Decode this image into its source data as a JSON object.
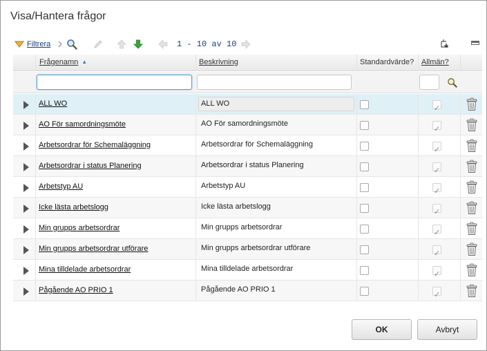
{
  "dialog": {
    "title": "Visa/Hantera frågor"
  },
  "toolbar": {
    "filter_label": "Filtrera",
    "pager_text": "1 - 10 av 10"
  },
  "columns": {
    "name": "Frågenamn",
    "description": "Beskrivning",
    "default": "Standardvärde?",
    "public": "Allmän?"
  },
  "filters": {
    "name_value": "",
    "description_value": "",
    "public_value": ""
  },
  "rows": [
    {
      "name": "ALL WO",
      "description": "ALL WO",
      "default": false,
      "public": true,
      "selected": true
    },
    {
      "name": "AO För samordningsmöte",
      "description": "AO För samordningsmöte",
      "default": false,
      "public": true
    },
    {
      "name": "Arbetsordrar för Schemaläggning",
      "description": "Arbetsordrar för Schemaläggning",
      "default": false,
      "public": true
    },
    {
      "name": "Arbetsordrar i status Planering",
      "description": "Arbetsordrar i status Planering",
      "default": false,
      "public": true
    },
    {
      "name": "Arbetstyp AU",
      "description": "Arbetstyp AU",
      "default": false,
      "public": true
    },
    {
      "name": "Icke lästa arbetslogg",
      "description": "Icke lästa arbetslogg",
      "default": false,
      "public": true
    },
    {
      "name": "Min grupps arbetsordrar",
      "description": "Min grupps arbetsordrar",
      "default": false,
      "public": true
    },
    {
      "name": "Min grupps arbetsordrar utförare",
      "description": "Min grupps arbetsordrar utförare",
      "default": false,
      "public": true
    },
    {
      "name": "Mina tilldelade arbetsordrar",
      "description": "Mina tilldelade arbetsordrar",
      "default": false,
      "public": true
    },
    {
      "name": "Pågående AO PRIO 1",
      "description": "Pågående AO PRIO 1",
      "default": false,
      "public": true
    }
  ],
  "buttons": {
    "ok": "OK",
    "cancel": "Avbryt"
  },
  "icons": {
    "filter": "funnel-icon",
    "breadcrumb": "chevron-right-icon",
    "search": "magnifier-icon",
    "edit": "pencil-icon",
    "move_up": "arrow-up-icon",
    "move_down": "arrow-down-icon",
    "prev": "arrow-left-icon",
    "next": "arrow-right-icon",
    "export": "export-icon",
    "collapse": "minimize-icon",
    "expand_row": "triangle-right-icon",
    "delete": "trash-icon"
  },
  "colors": {
    "accent": "#1a3d7c",
    "selected_row": "#dff0f7",
    "down_arrow": "#3aa53a"
  }
}
